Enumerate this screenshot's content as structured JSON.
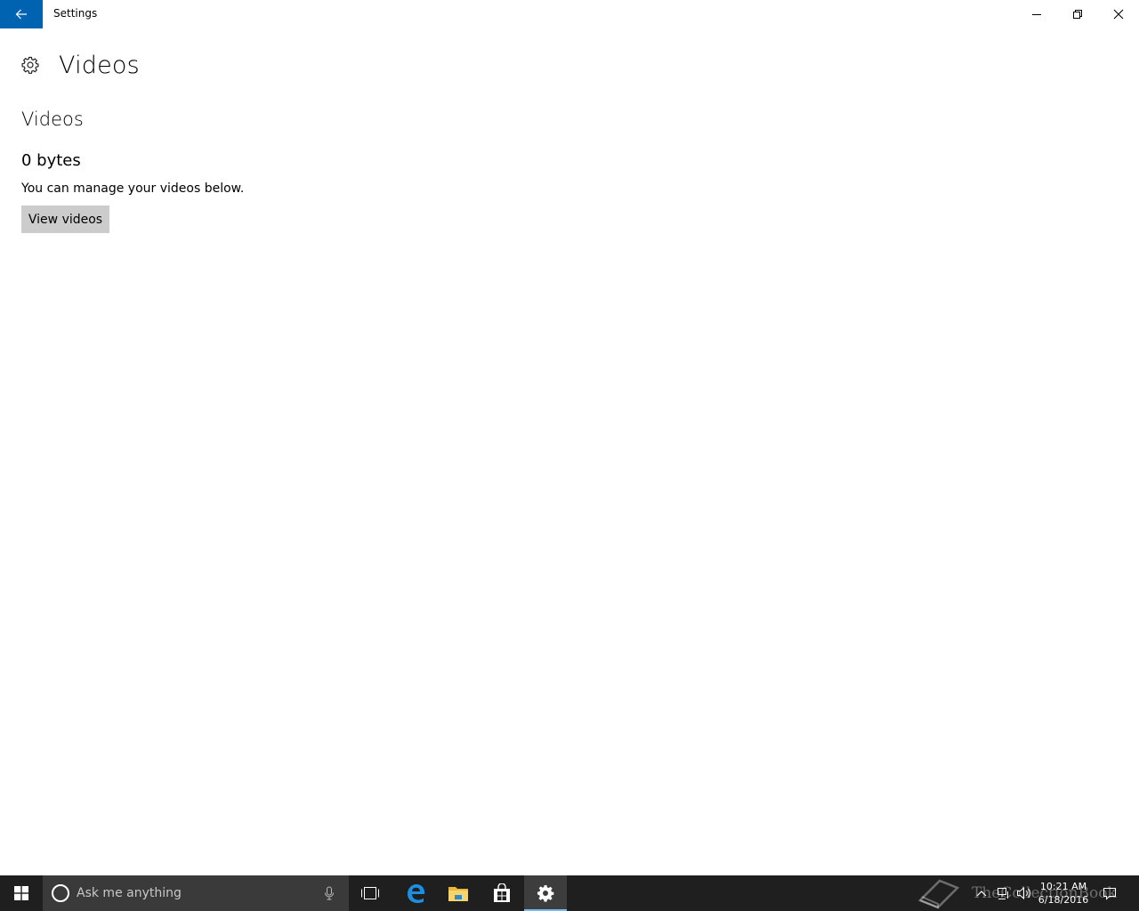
{
  "window": {
    "title": "Settings",
    "accent": "#0063b1"
  },
  "page": {
    "title": "Videos",
    "section_title": "Videos",
    "size": "0 bytes",
    "description": "You can manage your videos below.",
    "view_button": "View videos"
  },
  "taskbar": {
    "search_placeholder": "Ask me anything",
    "watermark": "TheCollectionBook",
    "time": "10:21 AM",
    "date": "6/18/2016",
    "active_indicator": "#76b9ed"
  }
}
